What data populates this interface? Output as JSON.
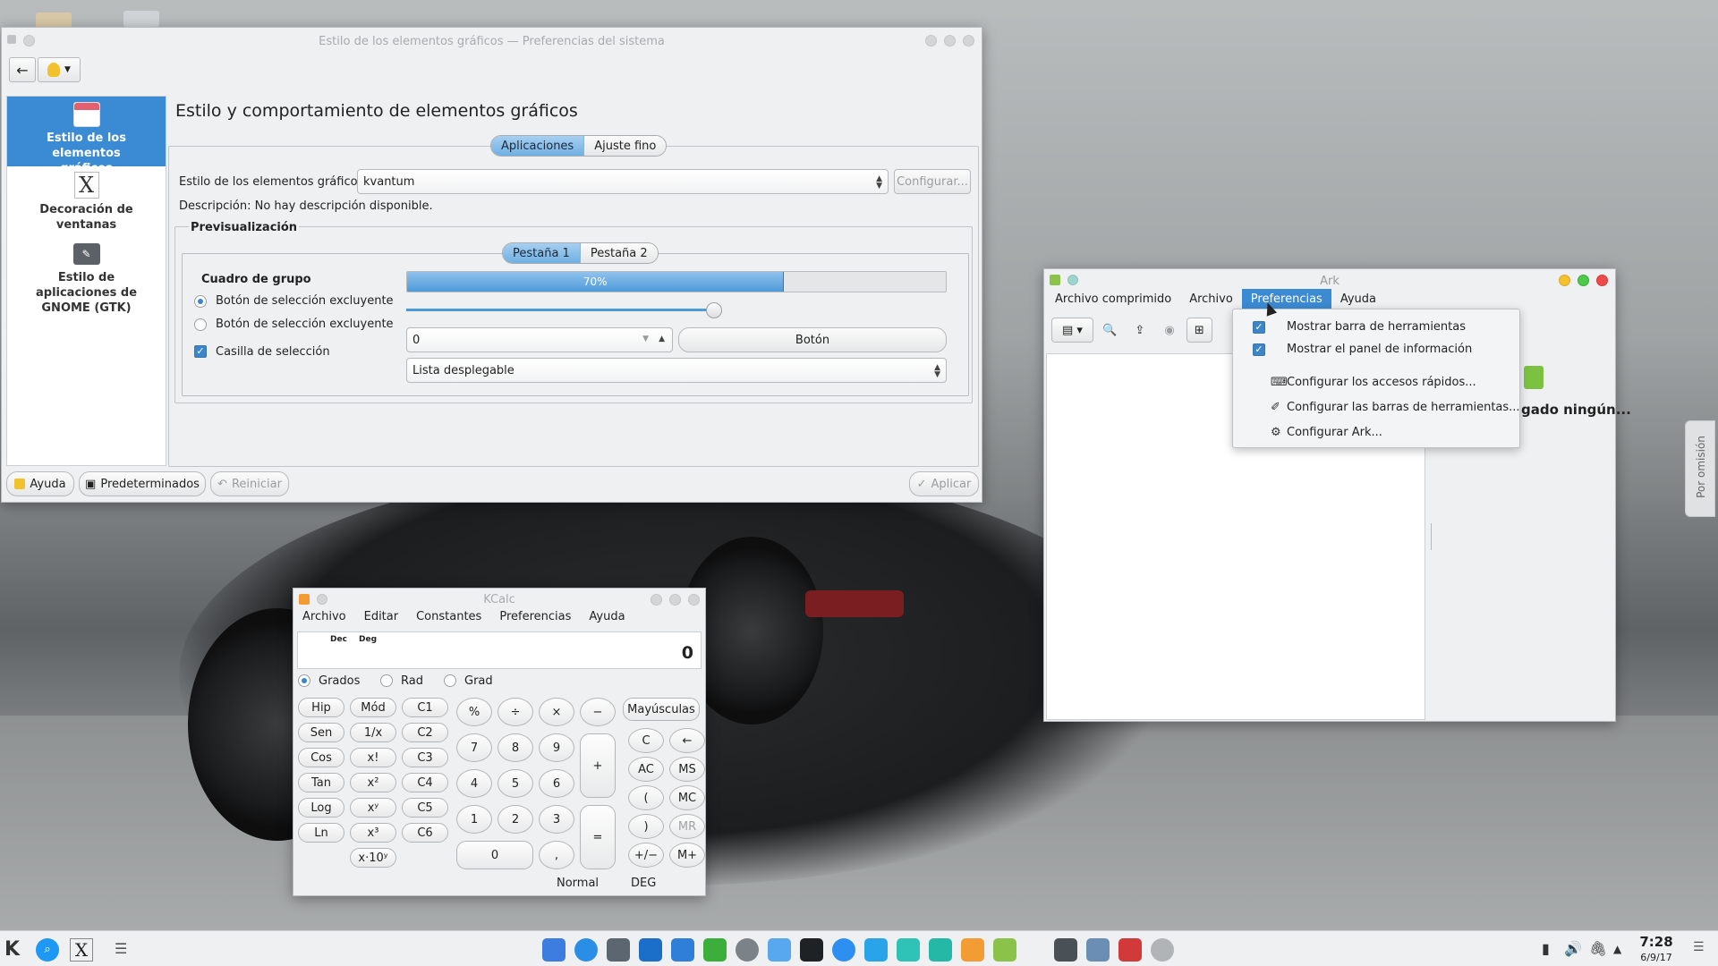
{
  "settings_window": {
    "title": "Estilo de los elementos gráficos — Preferencias del sistema",
    "sidebar": [
      {
        "label": "Estilo de los elementos gráficos",
        "icon": "widget-style-icon"
      },
      {
        "label": "Decoración de ventanas",
        "icon": "window-decoration-icon"
      },
      {
        "label": "Estilo de aplicaciones de GNOME (GTK)",
        "icon": "gtk-style-icon"
      }
    ],
    "heading": "Estilo y comportamiento de elementos gráficos",
    "tabs": [
      "Aplicaciones",
      "Ajuste fino"
    ],
    "style_label": "Estilo de los elementos gráficos:",
    "style_value": "kvantum",
    "configure_label": "Configurar...",
    "description": "Descripción: No hay descripción disponible.",
    "preview_title": "Previsualización",
    "preview_tabs": [
      "Pestaña 1",
      "Pestaña 2"
    ],
    "group_box": "Cuadro de grupo",
    "radio1": "Botón de selección excluyente",
    "radio2": "Botón de selección excluyente",
    "checkbox": "Casilla de selección",
    "progress_text": "70%",
    "progress_value": 0.7,
    "slider_value": 0.57,
    "spin_value": "0",
    "push_button": "Botón",
    "dropdown": "Lista desplegable",
    "footer": {
      "help": "Ayuda",
      "defaults": "Predeterminados",
      "reset": "Reiniciar",
      "apply": "Aplicar"
    }
  },
  "ark_window": {
    "title": "Ark",
    "menu": [
      "Archivo comprimido",
      "Archivo",
      "Preferencias",
      "Ayuda"
    ],
    "popup": [
      {
        "label": "Mostrar barra de herramientas",
        "checked": true
      },
      {
        "label": "Mostrar el panel de información",
        "checked": true
      },
      {
        "label": "Configurar los accesos rápidos...",
        "icon": "keyboard-icon"
      },
      {
        "label": "Configurar las barras de herramientas...",
        "icon": "toolbar-config-icon"
      },
      {
        "label": "Configurar Ark...",
        "icon": "gear-icon"
      }
    ],
    "info_text": "gado ningún..."
  },
  "side_tab": "Por omisión",
  "kcalc": {
    "title": "KCalc",
    "menu": [
      "Archivo",
      "Editar",
      "Constantes",
      "Preferencias",
      "Ayuda"
    ],
    "display_flags": [
      "Dec",
      "Deg"
    ],
    "display_value": "0",
    "angle_modes": [
      "Grados",
      "Rad",
      "Grad"
    ],
    "fn_buttons": [
      [
        "Hip",
        "Mód",
        "C1"
      ],
      [
        "Sen",
        "1/x",
        "C2"
      ],
      [
        "Cos",
        "x!",
        "C3"
      ],
      [
        "Tan",
        "x²",
        "C4"
      ],
      [
        "Log",
        "xʸ",
        "C5"
      ],
      [
        "Ln",
        "x³",
        "C6"
      ]
    ],
    "exp_button": "x·10ʸ",
    "ops": [
      "%",
      "÷",
      "×",
      "−"
    ],
    "digits": [
      [
        "7",
        "8",
        "9"
      ],
      [
        "4",
        "5",
        "6"
      ],
      [
        "1",
        "2",
        "3"
      ]
    ],
    "zero": "0",
    "dot": ",",
    "plus": "+",
    "equals": "=",
    "shift": "Mayúsculas",
    "right_buttons": [
      [
        "C",
        "←"
      ],
      [
        "AC",
        "MS"
      ],
      [
        "(",
        "MC"
      ],
      [
        ")",
        "MR"
      ],
      [
        "+/−",
        "M+"
      ]
    ],
    "status": [
      "Normal",
      "DEG"
    ]
  },
  "taskbar": {
    "time": "7:28",
    "date": "6/9/17"
  }
}
